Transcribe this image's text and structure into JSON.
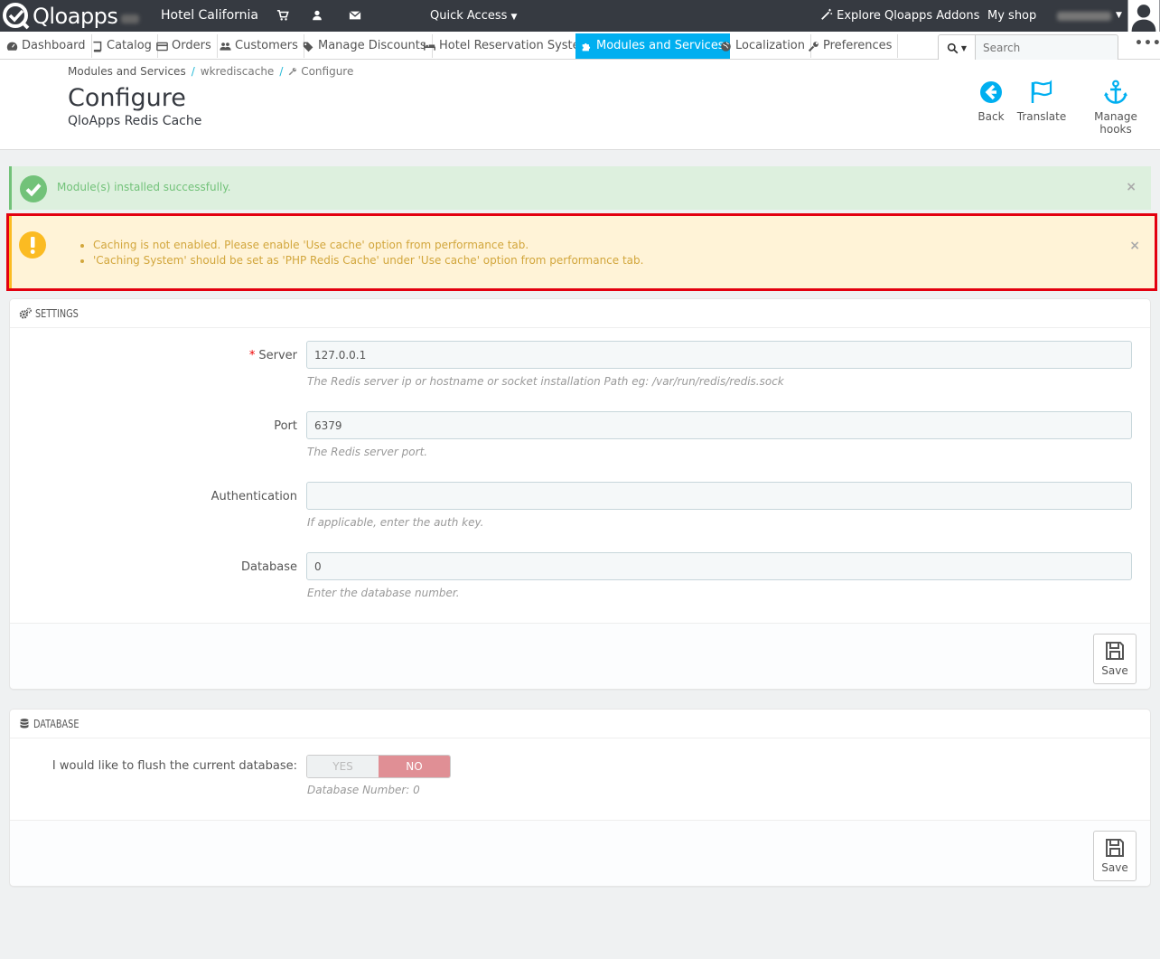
{
  "topbar": {
    "logo_text": "Qloapps",
    "shop_name": "Hotel California",
    "quick_access": "Quick Access",
    "explore_addons": "Explore Qloapps Addons",
    "my_shop": "My shop"
  },
  "navbar": {
    "items": [
      {
        "label": "Dashboard",
        "icon": "dashboard-icon"
      },
      {
        "label": "Catalog",
        "icon": "book-icon"
      },
      {
        "label": "Orders",
        "icon": "credit-card-icon"
      },
      {
        "label": "Customers",
        "icon": "users-icon"
      },
      {
        "label": "Manage Discounts",
        "icon": "tag-icon"
      },
      {
        "label": "Hotel Reservation System",
        "icon": "bed-icon"
      },
      {
        "label": "Modules and Services",
        "icon": "puzzle-icon",
        "active": true
      },
      {
        "label": "Localization",
        "icon": "globe-icon"
      },
      {
        "label": "Preferences",
        "icon": "wrench-icon"
      }
    ],
    "search_placeholder": "Search",
    "more": "•••"
  },
  "header": {
    "breadcrumb": [
      "Modules and Services",
      "wkrediscache",
      "Configure"
    ],
    "title": "Configure",
    "subtitle": "QloApps Redis Cache",
    "toolbar": {
      "back": "Back",
      "translate": "Translate",
      "manage_hooks": "Manage hooks"
    }
  },
  "alerts": {
    "success": "Module(s) installed successfully.",
    "close": "×",
    "warnings": [
      "Caching is not enabled. Please enable 'Use cache' option from performance tab.",
      "'Caching System' should be set as 'PHP Redis Cache' under 'Use cache' option from performance tab."
    ]
  },
  "settings": {
    "heading": "SETTINGS",
    "server": {
      "label": "Server",
      "required": "*",
      "value": "127.0.0.1",
      "help": "The Redis server ip or hostname or socket installation Path eg: /var/run/redis/redis.sock"
    },
    "port": {
      "label": "Port",
      "value": "6379",
      "help": "The Redis server port."
    },
    "auth": {
      "label": "Authentication",
      "value": "",
      "help": "If applicable, enter the auth key."
    },
    "database": {
      "label": "Database",
      "value": "0",
      "help": "Enter the database number."
    },
    "save": "Save"
  },
  "database_panel": {
    "heading": "DATABASE",
    "flush_label": "I would like to flush the current database:",
    "yes": "YES",
    "no": "NO",
    "selected": "NO",
    "help": "Database Number: 0",
    "save": "Save"
  },
  "colors": {
    "topbar": "#363a41",
    "accent": "#00aff0",
    "success": "#72c279",
    "warning": "#fbbb22",
    "highlight_frame": "#e3000f",
    "switch_no": "#e08f95"
  }
}
